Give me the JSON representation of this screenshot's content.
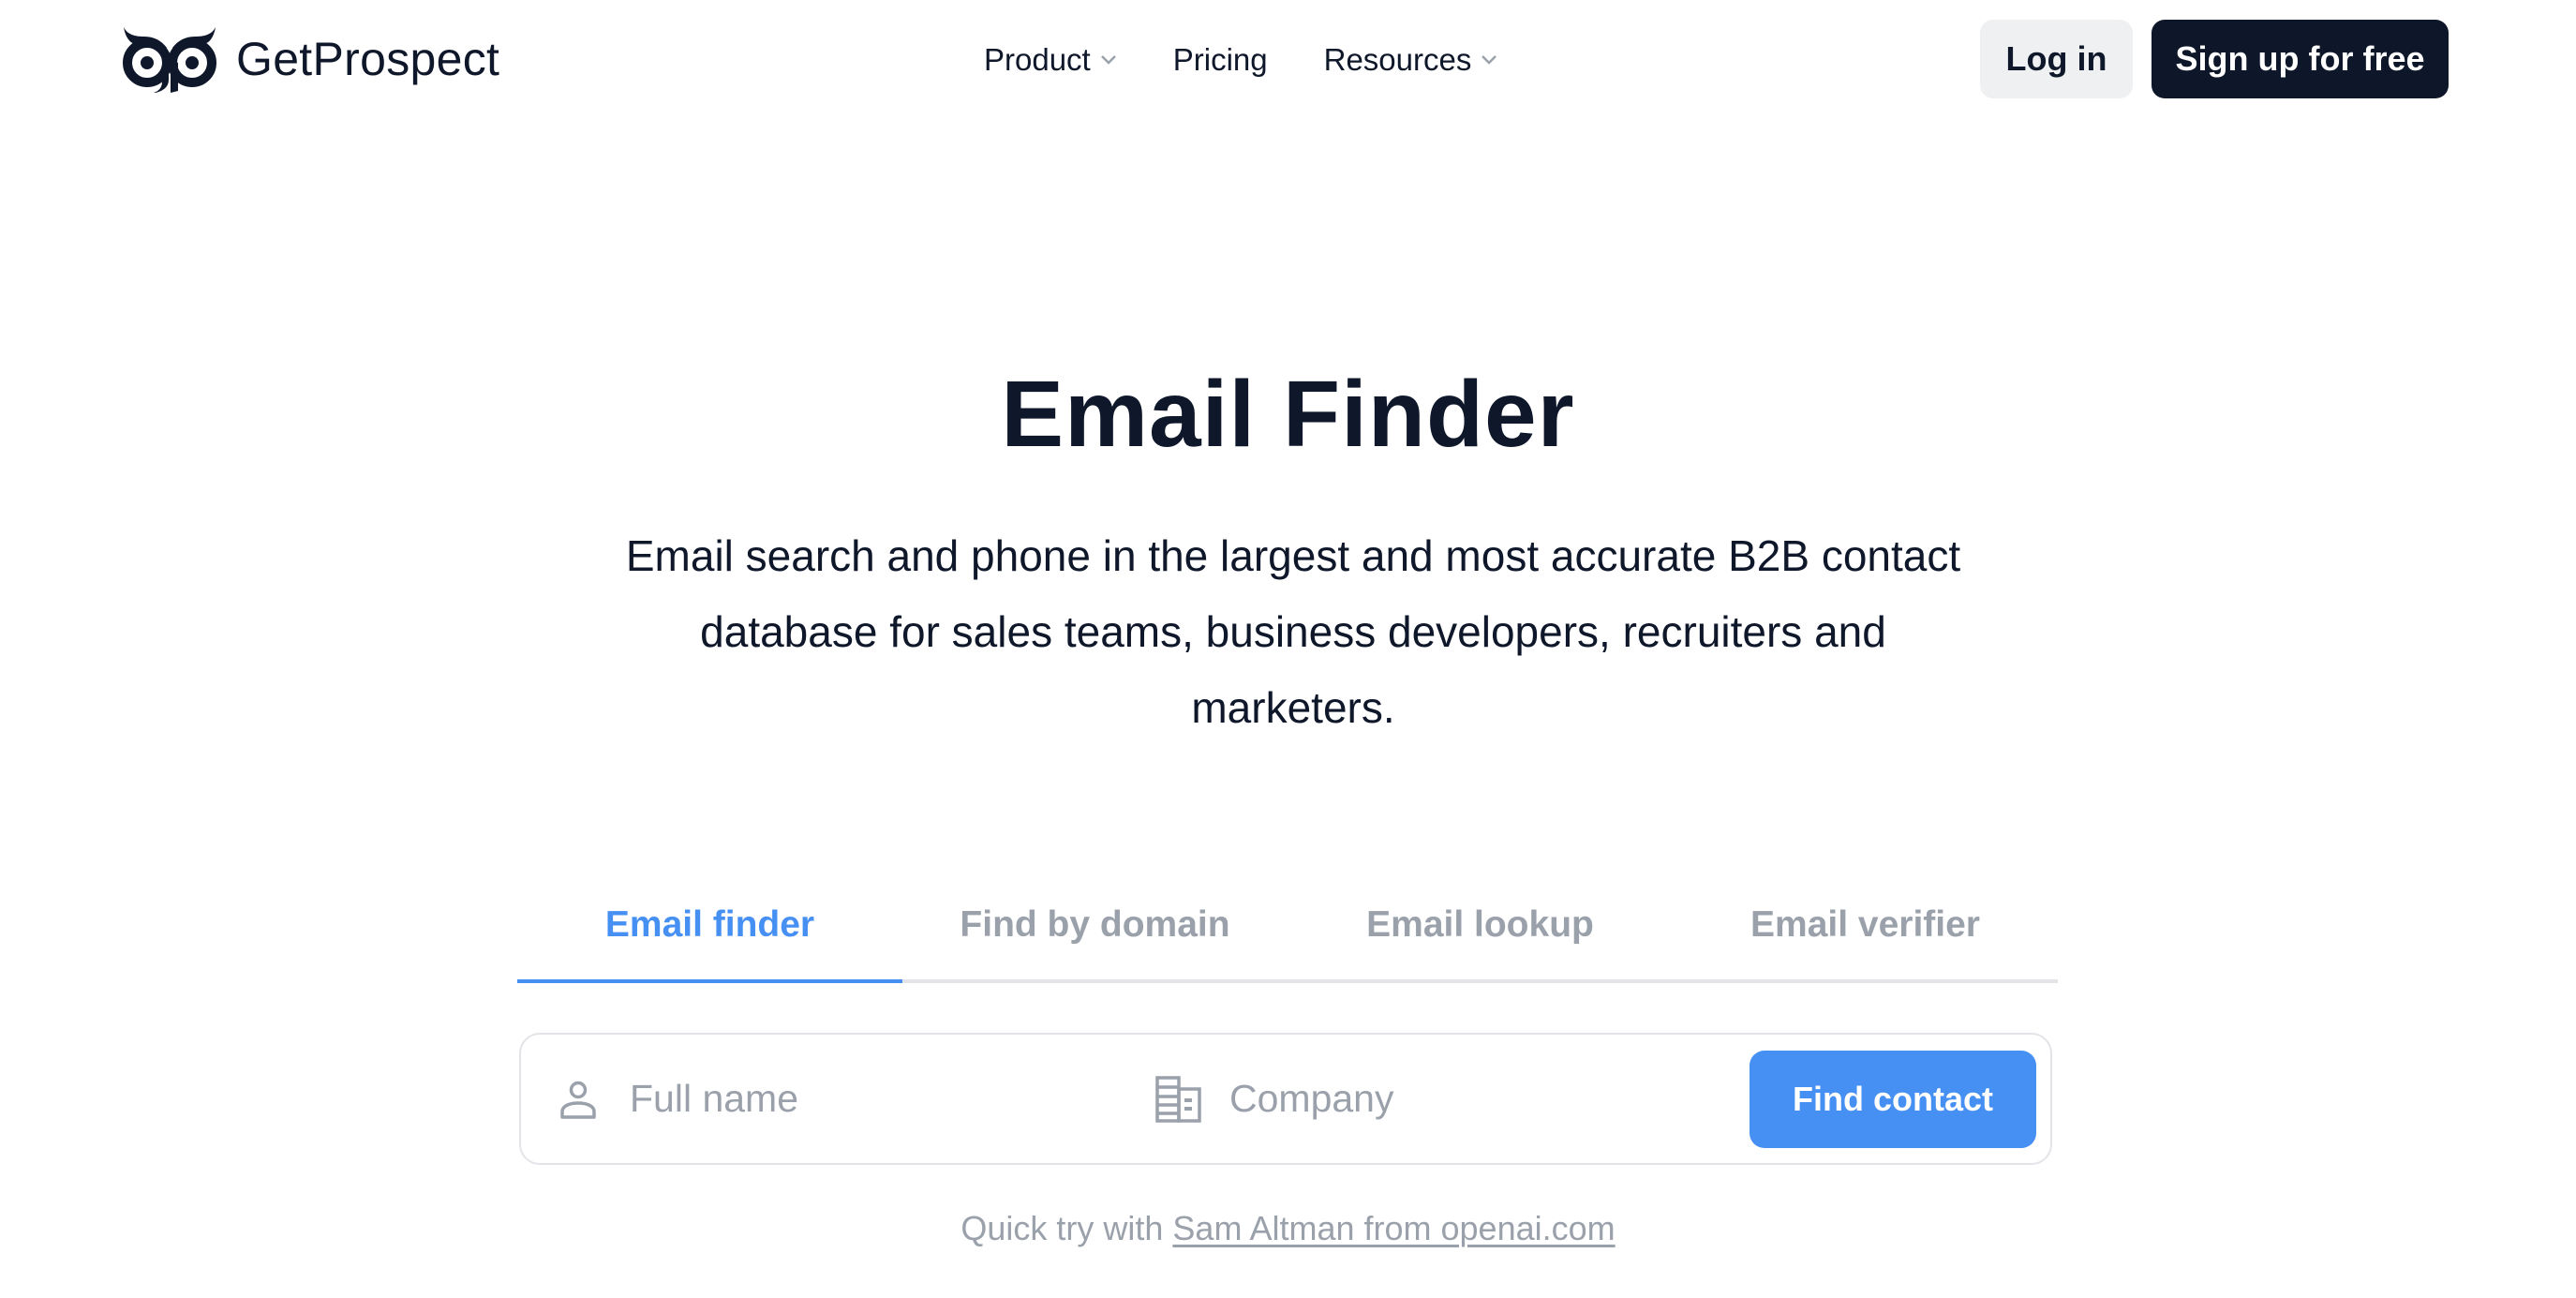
{
  "header": {
    "brand": "GetProspect",
    "logo_icon": "owl-logo-icon",
    "nav": [
      {
        "label": "Product",
        "has_dropdown": true
      },
      {
        "label": "Pricing",
        "has_dropdown": false
      },
      {
        "label": "Resources",
        "has_dropdown": true
      }
    ],
    "login_label": "Log in",
    "signup_label": "Sign up for free"
  },
  "hero": {
    "title": "Email Finder",
    "subtitle": "Email search and phone in the largest and most accurate B2B contact database for sales teams, business developers, recruiters and marketers."
  },
  "tabs": {
    "active_index": 0,
    "items": [
      {
        "label": "Email finder"
      },
      {
        "label": "Find by domain"
      },
      {
        "label": "Email lookup"
      },
      {
        "label": "Email verifier"
      }
    ]
  },
  "search": {
    "full_name": {
      "value": "",
      "placeholder": "Full name",
      "icon": "user-icon"
    },
    "company": {
      "value": "",
      "placeholder": "Company",
      "icon": "building-icon"
    },
    "submit_label": "Find contact"
  },
  "quick_try": {
    "prefix": "Quick try with",
    "link_label": "Sam Altman from openai.com"
  },
  "colors": {
    "primary": "#4790f3",
    "dark": "#0e1629",
    "muted": "#9aa1ab",
    "light_button": "#eff0f2",
    "border": "#e2e4e8"
  }
}
